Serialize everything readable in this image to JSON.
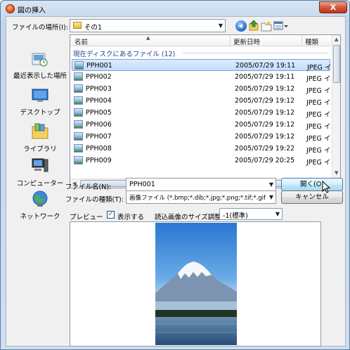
{
  "window": {
    "title": "図の挿入",
    "close_label": "X"
  },
  "location": {
    "label": "ファイルの場所(I):",
    "value": "その1"
  },
  "toolbar": {
    "back_icon": "back-icon",
    "up_icon": "up-folder-icon",
    "new_folder_icon": "new-folder-icon",
    "views_icon": "views-icon"
  },
  "places": [
    {
      "label": "最近表示した場所",
      "icon": "recent-places-icon"
    },
    {
      "label": "デスクトップ",
      "icon": "desktop-icon"
    },
    {
      "label": "ライブラリ",
      "icon": "libraries-icon"
    },
    {
      "label": "コンピューター",
      "icon": "computer-icon"
    },
    {
      "label": "ネットワーク",
      "icon": "network-icon"
    }
  ],
  "filelist": {
    "columns": [
      "名前",
      "更新日時",
      "種類"
    ],
    "group_label": "現在ディスクにあるファイル (12)",
    "rows": [
      {
        "name": "PPH001",
        "date": "2005/07/29 19:11",
        "type": "JPEG イメ-",
        "selected": true
      },
      {
        "name": "PPH002",
        "date": "2005/07/29 19:11",
        "type": "JPEG イメ-"
      },
      {
        "name": "PPH003",
        "date": "2005/07/29 19:12",
        "type": "JPEG イメ-"
      },
      {
        "name": "PPH004",
        "date": "2005/07/29 19:12",
        "type": "JPEG イメ-"
      },
      {
        "name": "PPH005",
        "date": "2005/07/29 19:12",
        "type": "JPEG イメ-"
      },
      {
        "name": "PPH006",
        "date": "2005/07/29 19:12",
        "type": "JPEG イメ-"
      },
      {
        "name": "PPH007",
        "date": "2005/07/29 19:12",
        "type": "JPEG イメ-"
      },
      {
        "name": "PPH008",
        "date": "2005/07/29 19:22",
        "type": "JPEG イメ-"
      },
      {
        "name": "PPH009",
        "date": "2005/07/29 20:25",
        "type": "JPEG イメ-"
      }
    ],
    "scroll_grip": "III"
  },
  "filename": {
    "label": "ファイル名(N):",
    "value": "PPH001"
  },
  "filetype": {
    "label": "ファイルの種類(T):",
    "value": "画像ファイル (*.bmp;*.dib;*.jpg;*.png;*.tif;*.gif;*.psd;*.fp"
  },
  "buttons": {
    "open": "開く(O)",
    "cancel": "キャンセル"
  },
  "preview": {
    "label": "プレビュー",
    "show_label": "表示する",
    "show_checked": true,
    "size_label": "読込画像のサイズ調整:",
    "size_value": "-1(標準)"
  }
}
